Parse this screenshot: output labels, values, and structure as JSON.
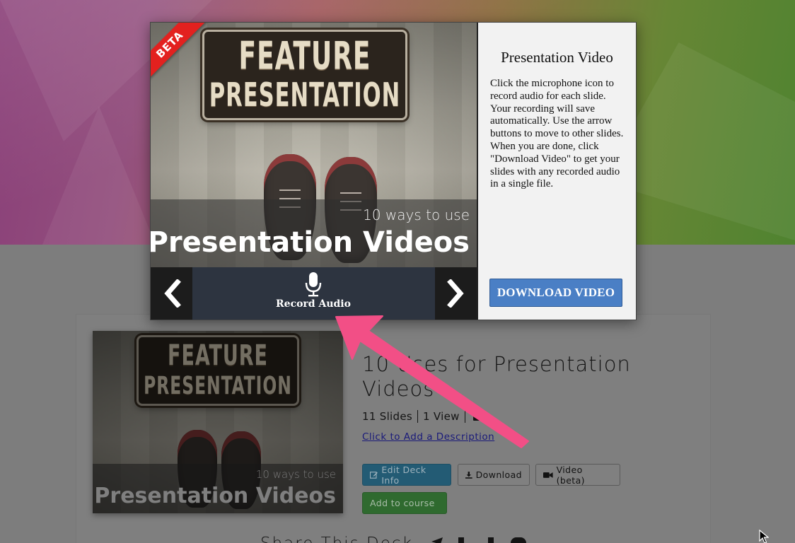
{
  "modal": {
    "beta_badge": "BETA",
    "slide": {
      "sign_line_1": "FEATURE",
      "sign_line_2": "PRESENTATION",
      "caption_small": "10 ways to use",
      "caption_big": "Presentation Videos"
    },
    "record_audio_label": "Record Audio",
    "title": "Presentation Video",
    "instructions": "Click the microphone icon to record audio for each slide. Your recording will save automatically. Use the arrow buttons to move to other slides. When you are done, click \"Download Video\" to get your slides with any recorded audio in a single file.",
    "download_button": "DOWNLOAD VIDEO"
  },
  "deck": {
    "thumbnail": {
      "sign_line_1": "FEATURE",
      "sign_line_2": "PRESENTATION",
      "caption_small": "10 ways to use",
      "caption_big": "Presentation Videos"
    },
    "title": "10 Uses for Presentation Videos",
    "slides": "11 Slides",
    "views": "1 View",
    "add_description_link": "Click to Add a Description",
    "buttons": {
      "edit": "Edit Deck Info",
      "download": "Download",
      "video": "Video (beta)",
      "add_course": "Add to course"
    },
    "share_text": "Share This Deck"
  },
  "icons": {
    "microphone": "microphone-icon",
    "prev": "chevron-left-icon",
    "next": "chevron-right-icon",
    "edit": "pencil-square-icon",
    "download": "download-icon",
    "video": "video-camera-icon",
    "folder": "folder-icon",
    "share_telegram": "telegram-icon",
    "share_linkedin": "linkedin-icon",
    "share_facebook": "facebook-icon",
    "share_twitter": "twitter-icon",
    "cursor": "cursor-icon"
  },
  "colors": {
    "download_button": "#4a7fc5",
    "beta_ribbon": "#e3211f",
    "arrow": "#f24f86",
    "controls_bar": "#2d3440"
  }
}
